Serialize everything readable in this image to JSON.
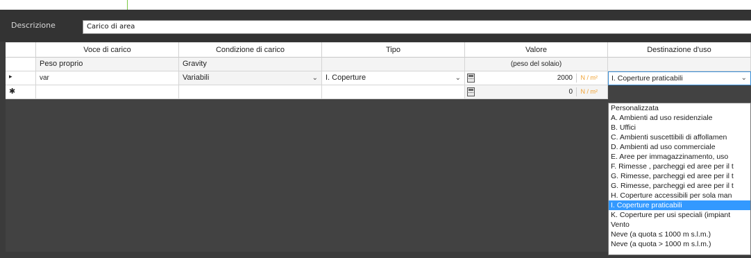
{
  "description": {
    "label": "Descrizione",
    "value": "Carico di area"
  },
  "columns": [
    "Voce di carico",
    "Condizione di carico",
    "Tipo",
    "Valore",
    "Destinazione d'uso"
  ],
  "rows": [
    {
      "marker": "",
      "voce": "Peso proprio",
      "condizione": "Gravity",
      "tipo": "",
      "valore_note": "(peso del solaio)",
      "destinazione": ""
    },
    {
      "marker": "▸",
      "voce": "var",
      "condizione": "Variabili",
      "tipo": "I. Coperture",
      "valore": "2000",
      "unit": "N / m²",
      "destinazione": "I. Coperture praticabili"
    },
    {
      "marker": "✱",
      "voce": "",
      "condizione": "",
      "tipo": "",
      "valore": "0",
      "unit": "N / m²",
      "destinazione": ""
    }
  ],
  "dropdown": {
    "selected_index": 11,
    "options": [
      "Personalizzata",
      "A. Ambienti ad uso residenziale",
      "B. Uffici",
      "C. Ambienti suscettibili di affollamen",
      "D. Ambienti ad uso commerciale",
      "E. Aree per immagazzinamento, uso",
      "F. Rimesse , parcheggi ed aree per il t",
      "G. Rimesse, parcheggi ed aree per il t",
      "G. Rimesse, parcheggi ed aree per il t",
      "H. Coperture accessibili per sola man",
      "I. Coperture praticabili",
      "K. Coperture per usi speciali (impiant",
      "Vento",
      "Neve (a quota ≤ 1000 m s.l.m.)",
      "Neve (a quota > 1000 m s.l.m.)"
    ]
  },
  "icons": {
    "combo_arrow": "chevron-down-icon",
    "value_editor": "calculator-icon"
  },
  "colors": {
    "accent": "#7ac943",
    "selection": "#3399ff",
    "unit": "#f0a030",
    "background": "#3b3b3b"
  }
}
